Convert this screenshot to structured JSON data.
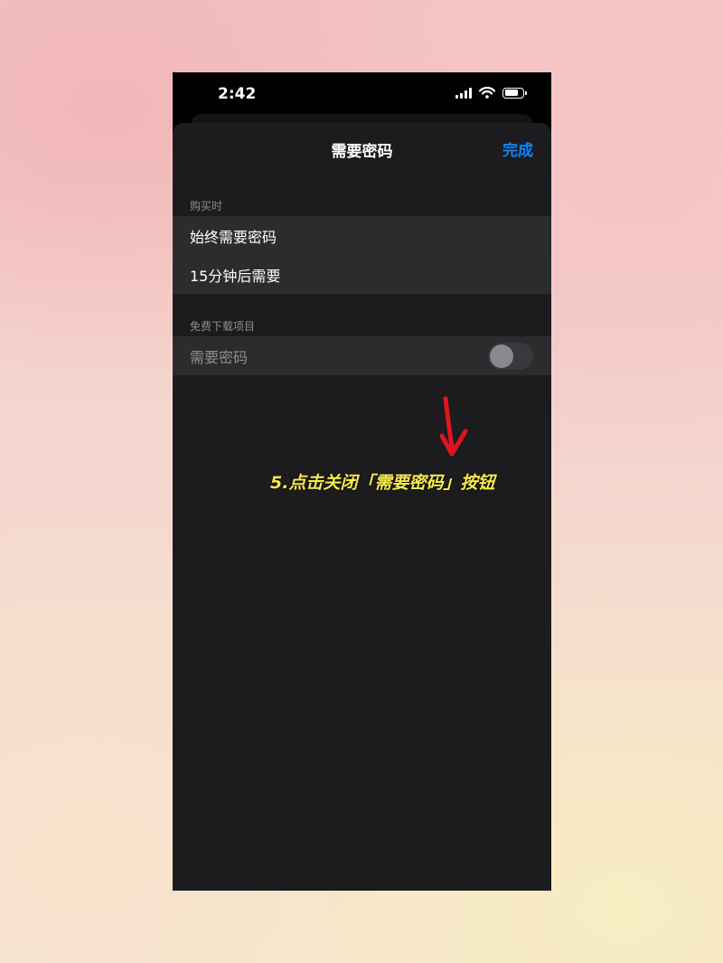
{
  "status_bar": {
    "time": "2:42"
  },
  "nav": {
    "title": "需要密码",
    "done_label": "完成"
  },
  "sections": [
    {
      "header": "购买时",
      "rows": [
        "始终需要密码",
        "15分钟后需要"
      ]
    },
    {
      "header": "免费下载项目",
      "rows": [
        "需要密码"
      ]
    }
  ],
  "toggle": {
    "state": "off"
  },
  "annotation": {
    "text": "5.点击关闭「需要密码」按钮",
    "color": "#f5ea4c",
    "arrow_color": "#e0141e"
  },
  "colors": {
    "accent": "#0a84ff",
    "sheet_bg": "#1c1c1e",
    "row_bg": "#2c2c2e"
  }
}
